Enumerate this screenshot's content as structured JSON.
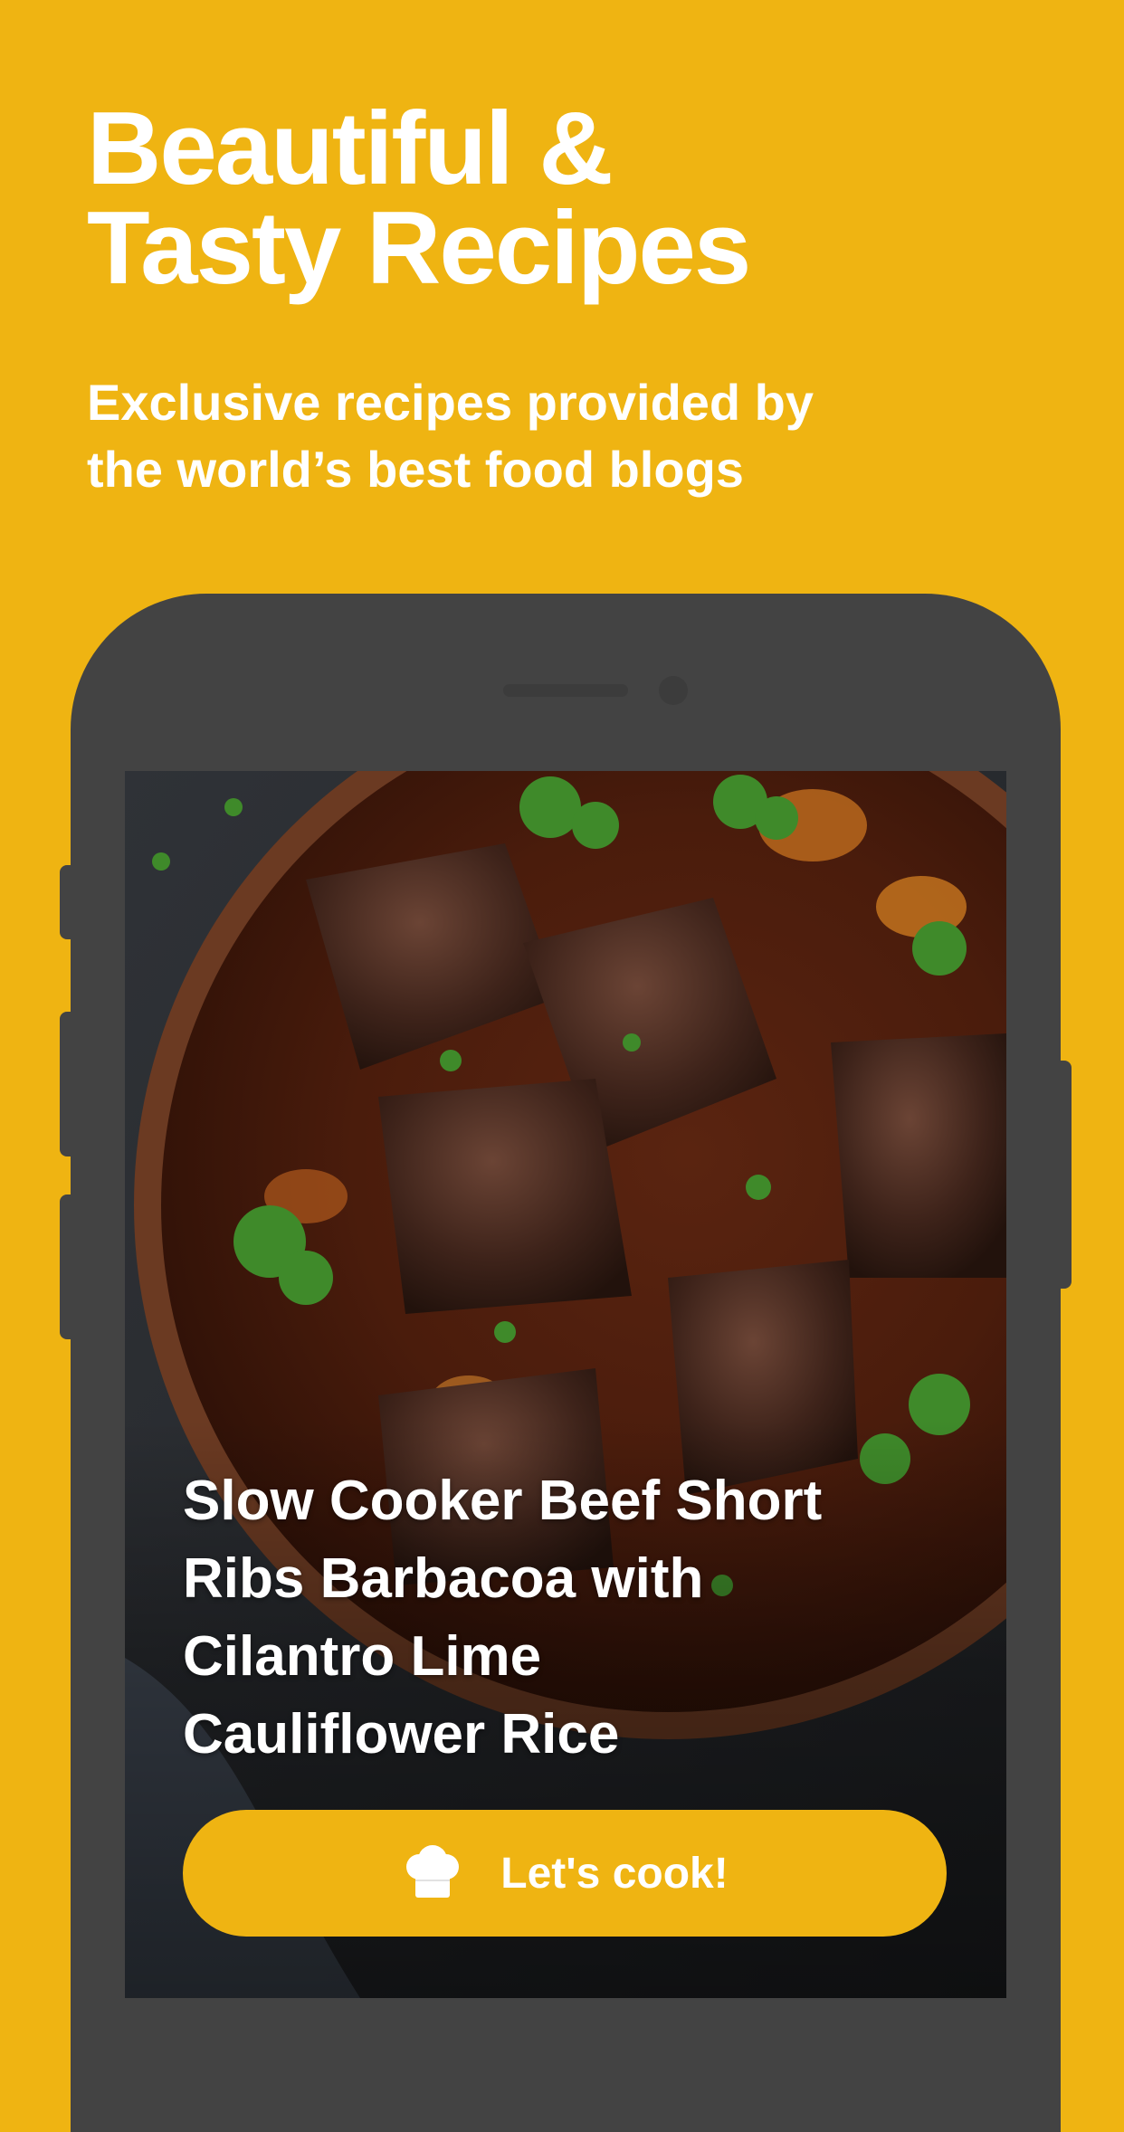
{
  "header": {
    "headline_line1": "Beautiful &",
    "headline_line2": "Tasty Recipes",
    "subhead_line1": "Exclusive recipes provided by",
    "subhead_line2": "the world’s best food blogs"
  },
  "recipe_card": {
    "title_line1": "Slow Cooker Beef Short",
    "title_line2": "Ribs Barbacoa with",
    "title_line3": "Cilantro Lime",
    "title_line4": "Cauliflower Rice",
    "button_label": "Let's cook!",
    "button_icon": "chef-hat-icon"
  },
  "colors": {
    "background": "#EFB412",
    "accent": "#EFB412",
    "phone_frame": "#434343",
    "text": "#FFFFFF"
  }
}
